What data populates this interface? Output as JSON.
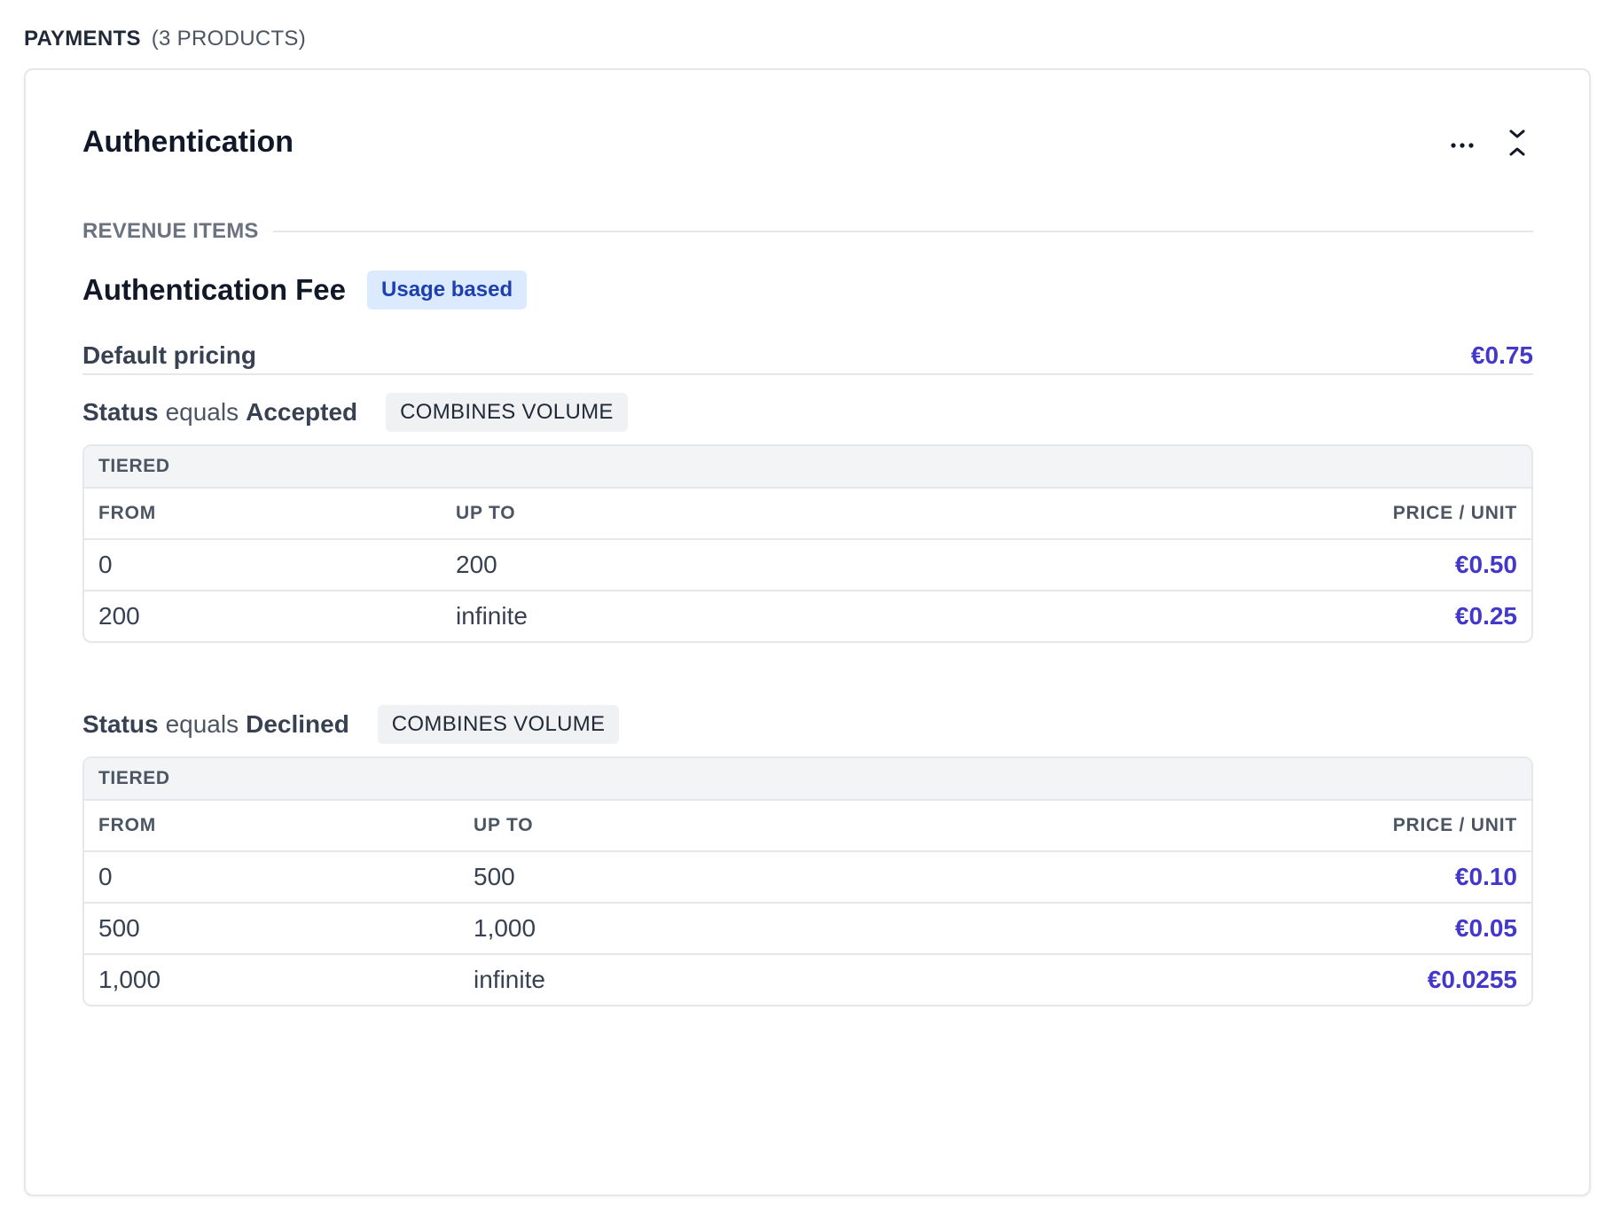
{
  "section": {
    "title": "PAYMENTS",
    "count": "(3 PRODUCTS)"
  },
  "product": {
    "title": "Authentication",
    "icons": {
      "more": "more-horizontal-icon",
      "collapse": "collapse-chevrons-icon"
    }
  },
  "revenue_items": {
    "label": "REVENUE ITEMS",
    "item_name": "Authentication Fee",
    "badge": "Usage based",
    "default_pricing_label": "Default pricing",
    "default_price": "€0.75"
  },
  "rules": [
    {
      "field": "Status",
      "operator": "equals",
      "value": "Accepted",
      "badge": "COMBINES VOLUME",
      "table_title": "TIERED",
      "columns": [
        "FROM",
        "UP TO",
        "PRICE / UNIT"
      ],
      "rows": [
        {
          "from": "0",
          "up_to": "200",
          "price": "€0.50"
        },
        {
          "from": "200",
          "up_to": "infinite",
          "price": "€0.25"
        }
      ]
    },
    {
      "field": "Status",
      "operator": "equals",
      "value": "Declined",
      "badge": "COMBINES VOLUME",
      "table_title": "TIERED",
      "columns": [
        "FROM",
        "UP TO",
        "PRICE / UNIT"
      ],
      "rows": [
        {
          "from": "0",
          "up_to": "500",
          "price": "€0.10"
        },
        {
          "from": "500",
          "up_to": "1,000",
          "price": "€0.05"
        },
        {
          "from": "1,000",
          "up_to": "infinite",
          "price": "€0.0255"
        }
      ]
    }
  ],
  "colors": {
    "price": "#4338ca",
    "usage_badge_bg": "#dbeafe",
    "usage_badge_text": "#1e40af",
    "border": "#e5e7eb"
  }
}
